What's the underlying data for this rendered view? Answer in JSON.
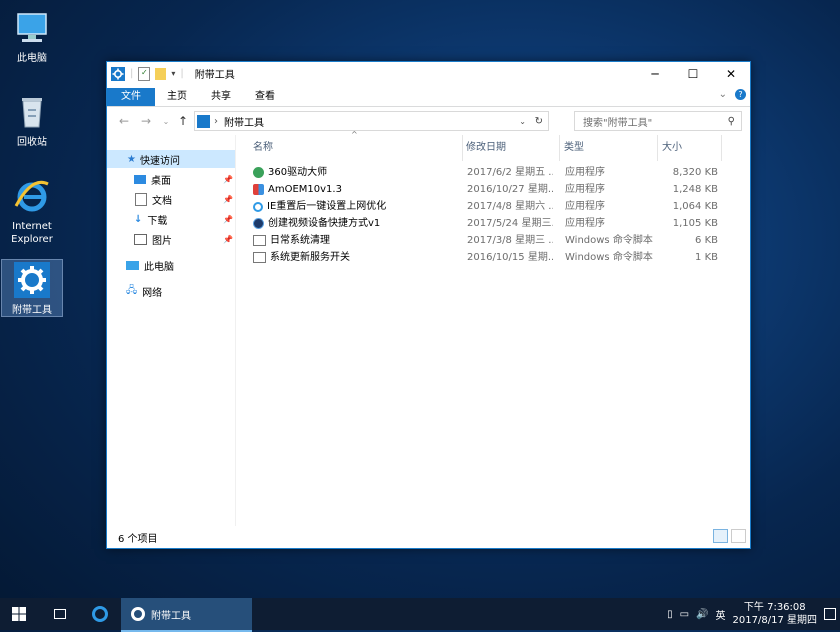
{
  "desktop": {
    "icons": [
      {
        "label": "此电脑",
        "icon": "computer-icon"
      },
      {
        "label": "回收站",
        "icon": "recycle-bin-icon"
      },
      {
        "label": "Internet Explorer",
        "icon": "ie-icon"
      },
      {
        "label": "附带工具",
        "icon": "gear-icon"
      }
    ]
  },
  "window": {
    "title": "附带工具",
    "controls": {
      "minimize": "─",
      "maximize": "☐",
      "close": "✕"
    },
    "ribbon": {
      "tabs": [
        "文件",
        "主页",
        "共享",
        "查看"
      ]
    },
    "address": {
      "path": "附带工具"
    },
    "search": {
      "placeholder": "搜索\"附带工具\""
    },
    "nav": {
      "quick_access": "快速访问",
      "pinned": [
        "桌面",
        "文档",
        "下载",
        "图片"
      ],
      "this_pc": "此电脑",
      "network": "网络"
    },
    "columns": {
      "name": "名称",
      "date": "修改日期",
      "type": "类型",
      "size": "大小"
    },
    "files": [
      {
        "name": "360驱动大师",
        "date": "2017/6/2 星期五 ...",
        "type": "应用程序",
        "size": "8,320 KB",
        "icon": "app-360-icon"
      },
      {
        "name": "AmOEM10v1.3",
        "date": "2016/10/27 星期...",
        "type": "应用程序",
        "size": "1,248 KB",
        "icon": "shield-app-icon"
      },
      {
        "name": "IE重置后一键设置上网优化",
        "date": "2017/4/8 星期六 ...",
        "type": "应用程序",
        "size": "1,064 KB",
        "icon": "ie-icon"
      },
      {
        "name": "创建视频设备快捷方式v1",
        "date": "2017/5/24 星期三...",
        "type": "应用程序",
        "size": "1,105 KB",
        "icon": "camera-app-icon"
      },
      {
        "name": "日常系统清理",
        "date": "2017/3/8 星期三 ...",
        "type": "Windows 命令脚本",
        "size": "6 KB",
        "icon": "script-icon"
      },
      {
        "name": "系统更新服务开关",
        "date": "2016/10/15 星期...",
        "type": "Windows 命令脚本",
        "size": "1 KB",
        "icon": "script-icon"
      }
    ],
    "status": {
      "count": "6 个项目"
    }
  },
  "taskbar": {
    "app_label": "附带工具",
    "tray": {
      "ime": "英",
      "time": "下午 7:36:08",
      "date": "2017/8/17 星期四"
    }
  },
  "colors": {
    "accent": "#1979ca",
    "selected": "#cce8ff",
    "taskbar": "#0e1d33"
  }
}
